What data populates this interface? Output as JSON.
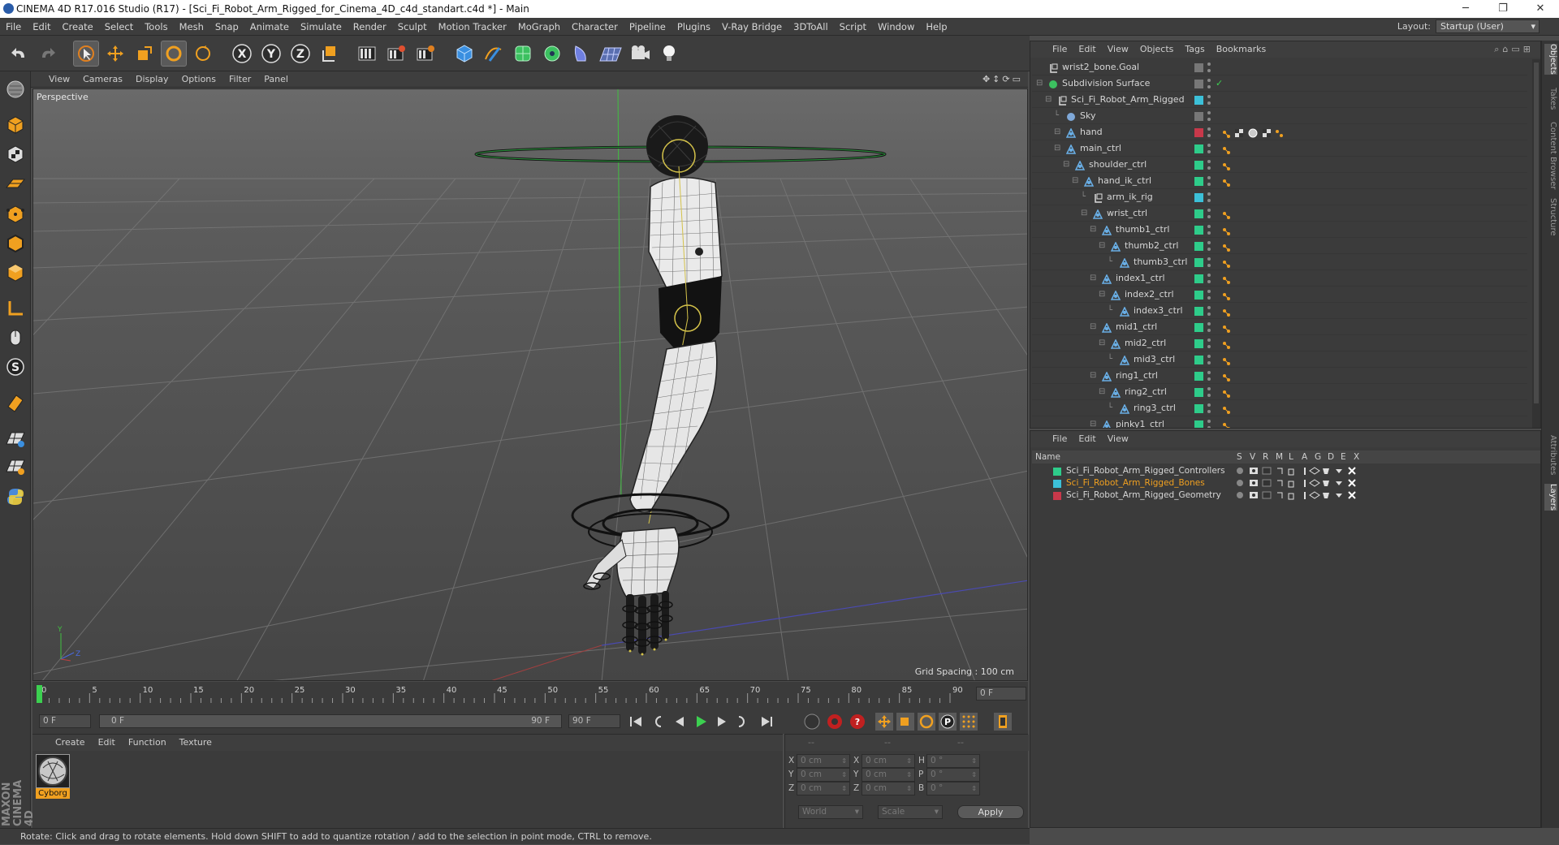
{
  "titlebar": {
    "title": "CINEMA 4D R17.016 Studio (R17) - [Sci_Fi_Robot_Arm_Rigged_for_Cinema_4D_c4d_standart.c4d *] - Main"
  },
  "menubar": {
    "items": [
      "File",
      "Edit",
      "Create",
      "Select",
      "Tools",
      "Mesh",
      "Snap",
      "Animate",
      "Simulate",
      "Render",
      "Sculpt",
      "Motion Tracker",
      "MoGraph",
      "Character",
      "Pipeline",
      "Plugins",
      "V-Ray Bridge",
      "3DToAll",
      "Script",
      "Window",
      "Help"
    ],
    "layout_label": "Layout:",
    "layout_value": "Startup (User)"
  },
  "viewport": {
    "menu": [
      "View",
      "Cameras",
      "Display",
      "Options",
      "Filter",
      "Panel"
    ],
    "label": "Perspective",
    "grid_spacing": "Grid Spacing : 100 cm"
  },
  "timeline": {
    "ticks": [
      "0",
      "5",
      "10",
      "15",
      "20",
      "25",
      "30",
      "35",
      "40",
      "45",
      "50",
      "55",
      "60",
      "65",
      "70",
      "75",
      "80",
      "85",
      "90"
    ],
    "end_field": "0 F",
    "current_frame": "0 F",
    "range_start": "0 F",
    "range_end": "90 F",
    "range_end2": "90 F"
  },
  "material_manager": {
    "menu": [
      "Create",
      "Edit",
      "Function",
      "Texture"
    ],
    "material_name": "Cyborg"
  },
  "coords": {
    "head": [
      "--",
      "--",
      "--"
    ],
    "rows": [
      {
        "a": "X",
        "av": "0 cm",
        "b": "X",
        "bv": "0 cm",
        "c": "H",
        "cv": "0 °"
      },
      {
        "a": "Y",
        "av": "0 cm",
        "b": "Y",
        "bv": "0 cm",
        "c": "P",
        "cv": "0 °"
      },
      {
        "a": "Z",
        "av": "0 cm",
        "b": "Z",
        "bv": "0 cm",
        "c": "B",
        "cv": "0 °"
      }
    ],
    "world": "World",
    "scale": "Scale",
    "apply": "Apply"
  },
  "statusbar": {
    "text": "Rotate: Click and drag to rotate elements. Hold down SHIFT to add to quantize rotation / add to the selection in point mode, CTRL to remove."
  },
  "object_manager": {
    "menu": [
      "File",
      "Edit",
      "View",
      "Objects",
      "Tags",
      "Bookmarks"
    ],
    "rows": [
      {
        "name": "wrist2_bone.Goal",
        "indent": 0,
        "color": "#777777",
        "icon": "null"
      },
      {
        "name": "Subdivision Surface",
        "indent": 0,
        "color": "#777777",
        "icon": "subd"
      },
      {
        "name": "Sci_Fi_Robot_Arm_Rigged",
        "indent": 1,
        "color": "#3cc0d8",
        "icon": "null"
      },
      {
        "name": "Sky",
        "indent": 2,
        "color": "#777777",
        "icon": "sky"
      },
      {
        "name": "hand",
        "indent": 2,
        "color": "#c8384a",
        "icon": "joint"
      },
      {
        "name": "main_ctrl",
        "indent": 2,
        "color": "#2ecc8a",
        "icon": "joint"
      },
      {
        "name": "shoulder_ctrl",
        "indent": 3,
        "color": "#2ecc8a",
        "icon": "joint"
      },
      {
        "name": "hand_ik_ctrl",
        "indent": 4,
        "color": "#2ecc8a",
        "icon": "joint"
      },
      {
        "name": "arm_ik_rig",
        "indent": 5,
        "color": "#3cc0d8",
        "icon": "null"
      },
      {
        "name": "wrist_ctrl",
        "indent": 5,
        "color": "#2ecc8a",
        "icon": "joint"
      },
      {
        "name": "thumb1_ctrl",
        "indent": 6,
        "color": "#2ecc8a",
        "icon": "joint"
      },
      {
        "name": "thumb2_ctrl",
        "indent": 7,
        "color": "#2ecc8a",
        "icon": "joint"
      },
      {
        "name": "thumb3_ctrl",
        "indent": 8,
        "color": "#2ecc8a",
        "icon": "joint"
      },
      {
        "name": "index1_ctrl",
        "indent": 6,
        "color": "#2ecc8a",
        "icon": "joint"
      },
      {
        "name": "index2_ctrl",
        "indent": 7,
        "color": "#2ecc8a",
        "icon": "joint"
      },
      {
        "name": "index3_ctrl",
        "indent": 8,
        "color": "#2ecc8a",
        "icon": "joint"
      },
      {
        "name": "mid1_ctrl",
        "indent": 6,
        "color": "#2ecc8a",
        "icon": "joint"
      },
      {
        "name": "mid2_ctrl",
        "indent": 7,
        "color": "#2ecc8a",
        "icon": "joint"
      },
      {
        "name": "mid3_ctrl",
        "indent": 8,
        "color": "#2ecc8a",
        "icon": "joint"
      },
      {
        "name": "ring1_ctrl",
        "indent": 6,
        "color": "#2ecc8a",
        "icon": "joint"
      },
      {
        "name": "ring2_ctrl",
        "indent": 7,
        "color": "#2ecc8a",
        "icon": "joint"
      },
      {
        "name": "ring3_ctrl",
        "indent": 8,
        "color": "#2ecc8a",
        "icon": "joint"
      },
      {
        "name": "pinky1_ctrl",
        "indent": 6,
        "color": "#2ecc8a",
        "icon": "joint"
      }
    ]
  },
  "layer_manager": {
    "menu": [
      "File",
      "Edit",
      "View"
    ],
    "header": {
      "name": "Name",
      "cols": [
        "S",
        "V",
        "R",
        "M",
        "L",
        "A",
        "G",
        "D",
        "E",
        "X"
      ]
    },
    "layers": [
      {
        "name": "Sci_Fi_Robot_Arm_Rigged_Controllers",
        "color": "#2ecc8a",
        "text_color": "#d6d6d6"
      },
      {
        "name": "Sci_Fi_Robot_Arm_Rigged_Bones",
        "color": "#3cc0d8",
        "text_color": "#f0a020"
      },
      {
        "name": "Sci_Fi_Robot_Arm_Rigged_Geometry",
        "color": "#c8384a",
        "text_color": "#d6d6d6"
      }
    ]
  },
  "right_tabs": [
    "Objects",
    "Takes",
    "Content Browser",
    "Structure",
    "Attributes",
    "Layers"
  ],
  "brand": "MAXON CINEMA 4D"
}
